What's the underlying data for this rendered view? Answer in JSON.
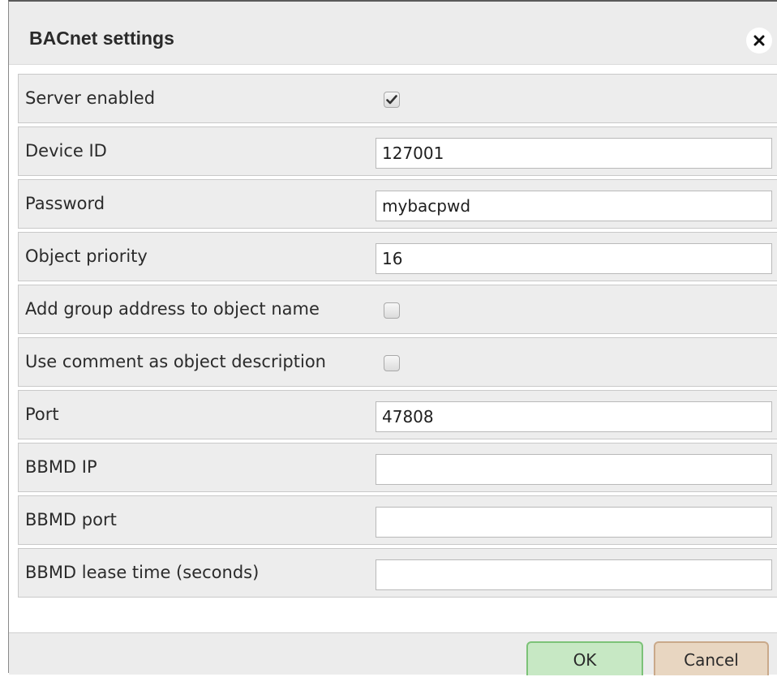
{
  "dialog": {
    "title": "BACnet settings",
    "close_icon": "close-icon"
  },
  "fields": [
    {
      "key": "server-enabled",
      "label": "Server enabled",
      "type": "checkbox",
      "checked": true
    },
    {
      "key": "device-id",
      "label": "Device ID",
      "type": "text",
      "value": "127001"
    },
    {
      "key": "password",
      "label": "Password",
      "type": "text",
      "value": "mybacpwd"
    },
    {
      "key": "object-priority",
      "label": "Object priority",
      "type": "text",
      "value": "16"
    },
    {
      "key": "add-group-address",
      "label": "Add group address to object name",
      "type": "checkbox",
      "checked": false
    },
    {
      "key": "use-comment",
      "label": "Use comment as object description",
      "type": "checkbox",
      "checked": false
    },
    {
      "key": "port",
      "label": "Port",
      "type": "text",
      "value": "47808"
    },
    {
      "key": "bbmd-ip",
      "label": "BBMD IP",
      "type": "text",
      "value": ""
    },
    {
      "key": "bbmd-port",
      "label": "BBMD port",
      "type": "text",
      "value": ""
    },
    {
      "key": "bbmd-lease-time",
      "label": "BBMD lease time (seconds)",
      "type": "text",
      "value": ""
    }
  ],
  "footer": {
    "ok_label": "OK",
    "cancel_label": "Cancel"
  },
  "colors": {
    "ok_bg": "#c7e8c4",
    "ok_border": "#7cc278",
    "cancel_bg": "#e8d6c1",
    "cancel_border": "#c9a98a",
    "row_bg": "#ededed",
    "header_bg": "#ececec"
  }
}
